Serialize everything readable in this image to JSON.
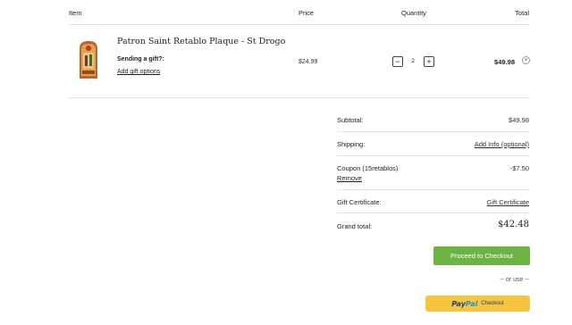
{
  "table_header": {
    "item": "Item",
    "price": "Price",
    "quantity": "Quantity",
    "total": "Total"
  },
  "line_item": {
    "name": "Patron Saint Retablo Plaque - St Drogo",
    "gift_question": "Sending a gift?:",
    "gift_link": "Add gift options",
    "price": "$24.99",
    "quantity": "2",
    "minus": "−",
    "plus": "+",
    "total": "$49.98",
    "remove_symbol": "×"
  },
  "summary": {
    "subtotal_label": "Subtotal:",
    "subtotal_value": "$49.98",
    "shipping_label": "Shipping:",
    "shipping_value": "Add Info (optional)",
    "coupon_label": "Coupon (15retablos)",
    "coupon_remove": "Remove",
    "coupon_value": "-$7.50",
    "gift_cert_label": "Gift Certificate:",
    "gift_cert_value": "Gift Certificate",
    "grand_label": "Grand total:",
    "grand_value": "$42.48"
  },
  "actions": {
    "checkout_label": "Proceed to Checkout",
    "or_use": "-- or use --",
    "paypal_pay": "Pay",
    "paypal_pal": "Pal",
    "paypal_checkout": "Checkout"
  },
  "colors": {
    "checkout_green": "#6db344",
    "paypal_yellow": "#f7c53d",
    "paypal_dark_blue": "#1a3f87",
    "paypal_light_blue": "#2a8fd4"
  }
}
